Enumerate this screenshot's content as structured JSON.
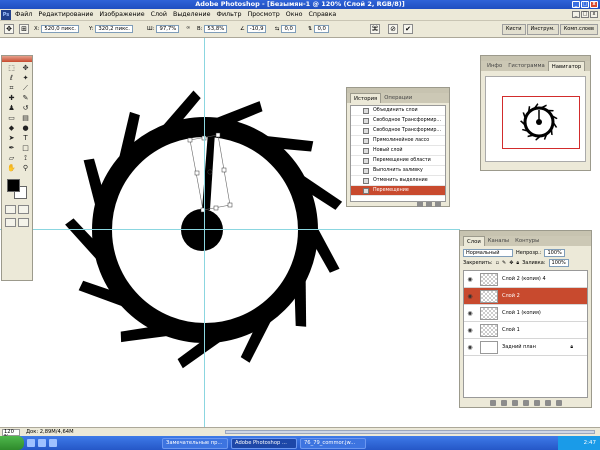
{
  "title": "Adobe Photoshop - [Безымян-1 @ 120% (Слой 2, RGB/8)]",
  "menu": [
    "Файл",
    "Редактирование",
    "Изображение",
    "Слой",
    "Выделение",
    "Фильтр",
    "Просмотр",
    "Окно",
    "Справка"
  ],
  "options": {
    "x_label": "X:",
    "x_value": "520,0 пикс.",
    "y_label": "Y:",
    "y_value": "320,2 пикс.",
    "w_label": "Ш:",
    "w_value": "97,7%",
    "h_label": "В:",
    "h_value": "53,8%",
    "angle_value": "-10,9",
    "hskew_value": "0,0",
    "vskew_value": "0,0"
  },
  "palette_well": [
    "Кисти",
    "Инструм.",
    "Комп.слоев"
  ],
  "history": {
    "tabs": [
      "История",
      "Операции"
    ],
    "items": [
      "Объединить слои",
      "Свободное Трансформир...",
      "Свободное Трансформир...",
      "Прямолинейное лассо",
      "Новый слой",
      "Перемещение области",
      "Выполнить заливку",
      "Отменить выделение",
      "Перемещение"
    ],
    "selected_index": 8
  },
  "navigator": {
    "tabs": [
      "Инфо",
      "Гистограмма",
      "Навигатор"
    ]
  },
  "layers": {
    "tabs": [
      "Слои",
      "Каналы",
      "Контуры"
    ],
    "blend_mode": "Нормальный",
    "opacity_label": "Непрозр.:",
    "opacity_value": "100%",
    "lock_label": "Закрепить:",
    "fill_label": "Заливка:",
    "fill_value": "100%",
    "items": [
      {
        "name": "Слой 2 (копия) 4",
        "selected": false
      },
      {
        "name": "Слой 2",
        "selected": true
      },
      {
        "name": "Слой 1 (копия)",
        "selected": false
      },
      {
        "name": "Слой 1",
        "selected": false
      },
      {
        "name": "Задний план",
        "selected": false,
        "locked": true
      }
    ]
  },
  "status": {
    "zoom": "120 %",
    "doc_info": "Док: 2,89M/4,64M"
  },
  "taskbar": {
    "buttons": [
      "Замечательные пр...",
      "Adobe Photoshop ...",
      "76_79_commor.jw..."
    ],
    "active_index": 1,
    "clock": "2:47"
  }
}
